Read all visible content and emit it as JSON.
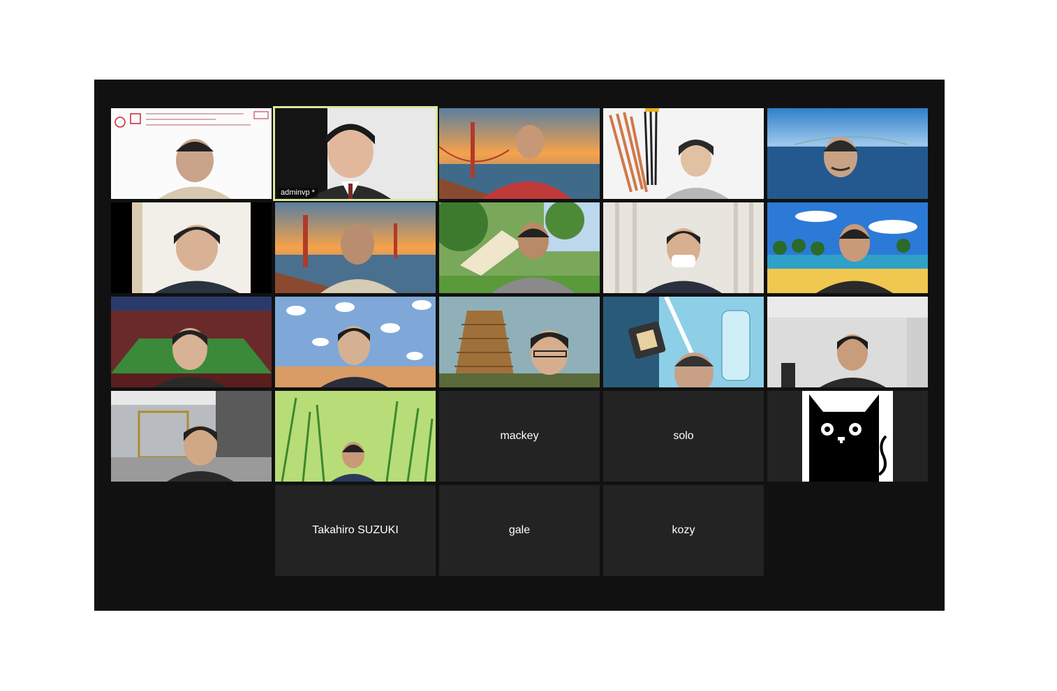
{
  "meeting": {
    "active_speaker_label": "adminvp *",
    "name_only_tiles": {
      "mackey": "mackey",
      "solo": "solo",
      "takahiro": "Takahiro SUZUKI",
      "gale": "gale",
      "kozy": "kozy"
    }
  },
  "colors": {
    "window_bg": "#111111",
    "tile_bg": "#232323",
    "active_outline": "#d8e89a"
  },
  "icons": [
    "cat-avatar-icon"
  ]
}
